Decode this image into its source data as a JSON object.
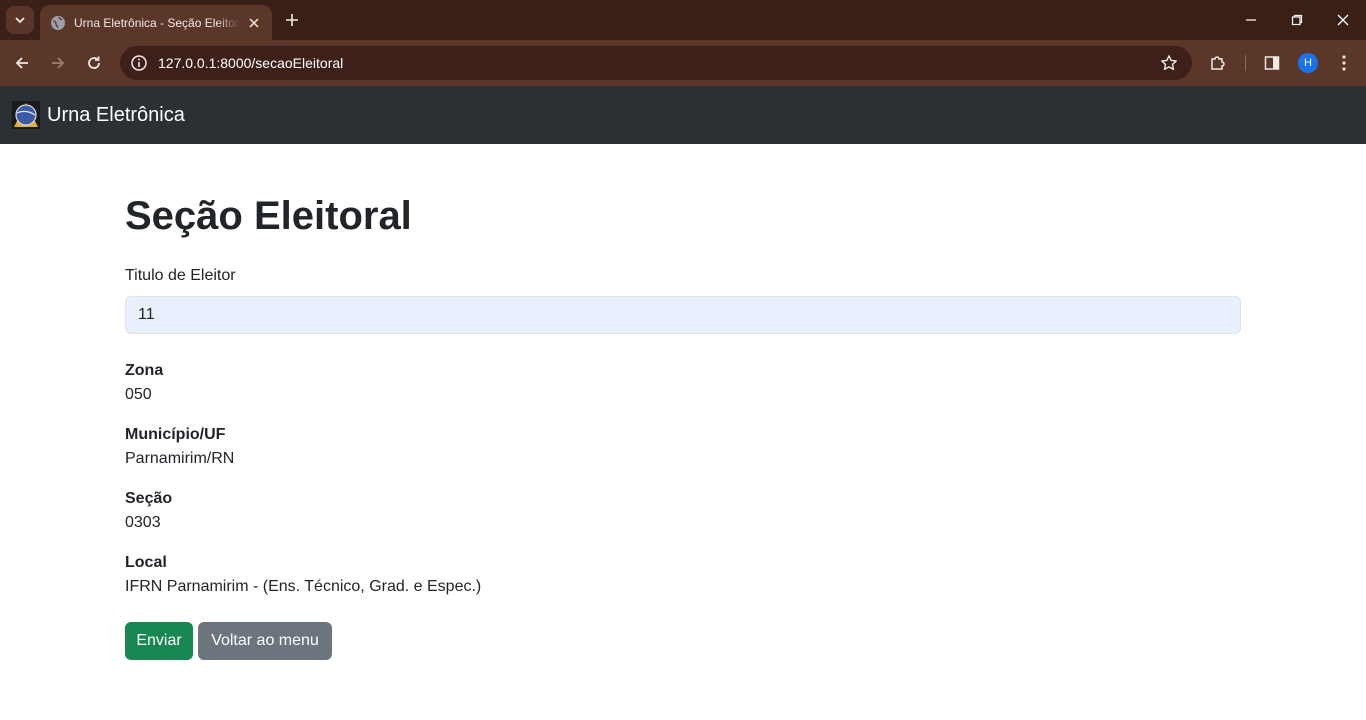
{
  "browser": {
    "tab_title": "Urna Eletrônica - Seção Eleitoral",
    "url": "127.0.0.1:8000/secaoEleitoral",
    "profile_initial": "H"
  },
  "navbar": {
    "brand": "Urna Eletrônica"
  },
  "page": {
    "title": "Seção Eleitoral",
    "input_label": "Titulo de Eleitor",
    "input_value": "11",
    "fields": [
      {
        "label": "Zona",
        "value": "050"
      },
      {
        "label": "Município/UF",
        "value": "Parnamirim/RN"
      },
      {
        "label": "Seção",
        "value": "0303"
      },
      {
        "label": "Local",
        "value": "IFRN Parnamirim - (Ens. Técnico, Grad. e Espec.)"
      }
    ],
    "buttons": {
      "submit": "Enviar",
      "back": "Voltar ao menu"
    }
  },
  "colors": {
    "navbar_bg": "#2b3035",
    "submit_bg": "#198754",
    "back_bg": "#6c757d",
    "input_bg": "#e8f0fe"
  }
}
